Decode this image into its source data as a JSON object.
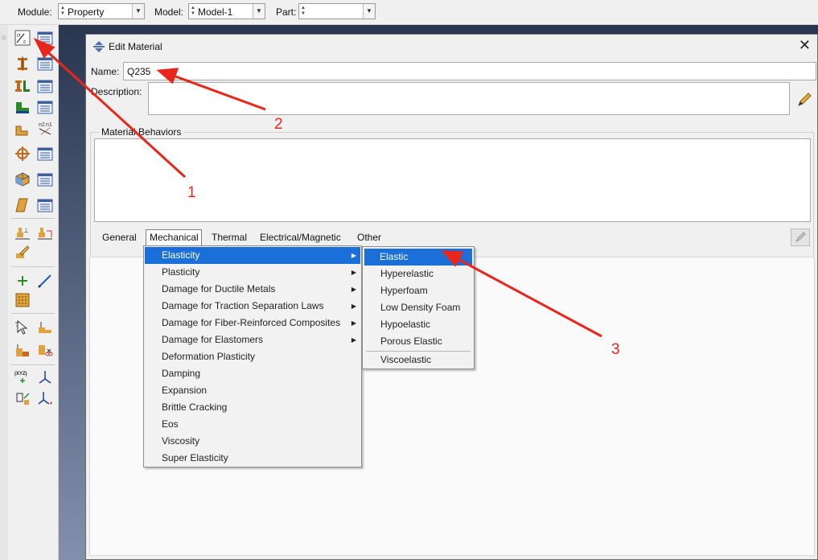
{
  "toolbar": {
    "module_label": "Module:",
    "module_value": "Property",
    "model_label": "Model:",
    "model_value": "Model-1",
    "part_label": "Part:",
    "part_value": ""
  },
  "toolbox": {
    "icons": [
      "stress-strain-icon",
      "material-manager-icon",
      "create-section-icon",
      "section-manager-icon",
      "assign-section-icon",
      "section-manager-icon-2",
      "beam-orientation-icon",
      "beam-normal-icon",
      "profile-icon",
      "profile-manager-icon",
      "composite-layup-icon",
      "composite-manager-icon",
      "skin-icon",
      "skin-manager-icon",
      "special-engineering-icon",
      "special-engineering-2-icon",
      "edit-pencil-icon",
      "datum-point-icon",
      "datum-axis-icon",
      "grid-icon",
      "query-icon",
      "set-icon",
      "partition-icon",
      "cut-icon",
      "csys-icon",
      "datum-csys-icon",
      "move-icon",
      "axes-icon"
    ]
  },
  "dialog": {
    "title": "Edit Material",
    "close_glyph": "✕",
    "name_label": "Name:",
    "name_value": "Q235",
    "description_label": "Description:",
    "behaviors_legend": "Material Behaviors",
    "tabs": {
      "general": "General",
      "mechanical": "Mechanical",
      "thermal": "Thermal",
      "electrical": "Electrical/Magnetic",
      "other": "Other"
    }
  },
  "mechanical_menu": {
    "items": [
      "Elasticity",
      "Plasticity",
      "Damage for Ductile Metals",
      "Damage for Traction Separation Laws",
      "Damage for Fiber-Reinforced Composites",
      "Damage for Elastomers",
      "Deformation Plasticity",
      "Damping",
      "Expansion",
      "Brittle Cracking",
      "Eos",
      "Viscosity",
      "Super Elasticity"
    ],
    "selected": "Elasticity"
  },
  "elasticity_submenu": {
    "items": [
      "Elastic",
      "Hyperelastic",
      "Hyperfoam",
      "Low Density Foam",
      "Hypoelastic",
      "Porous Elastic",
      "Viscoelastic"
    ],
    "selected": "Elastic"
  },
  "annotations": {
    "a1": "1",
    "a2": "2",
    "a3": "3"
  },
  "colors": {
    "selection": "#1a6fd8",
    "annotation": "#e8261b"
  }
}
